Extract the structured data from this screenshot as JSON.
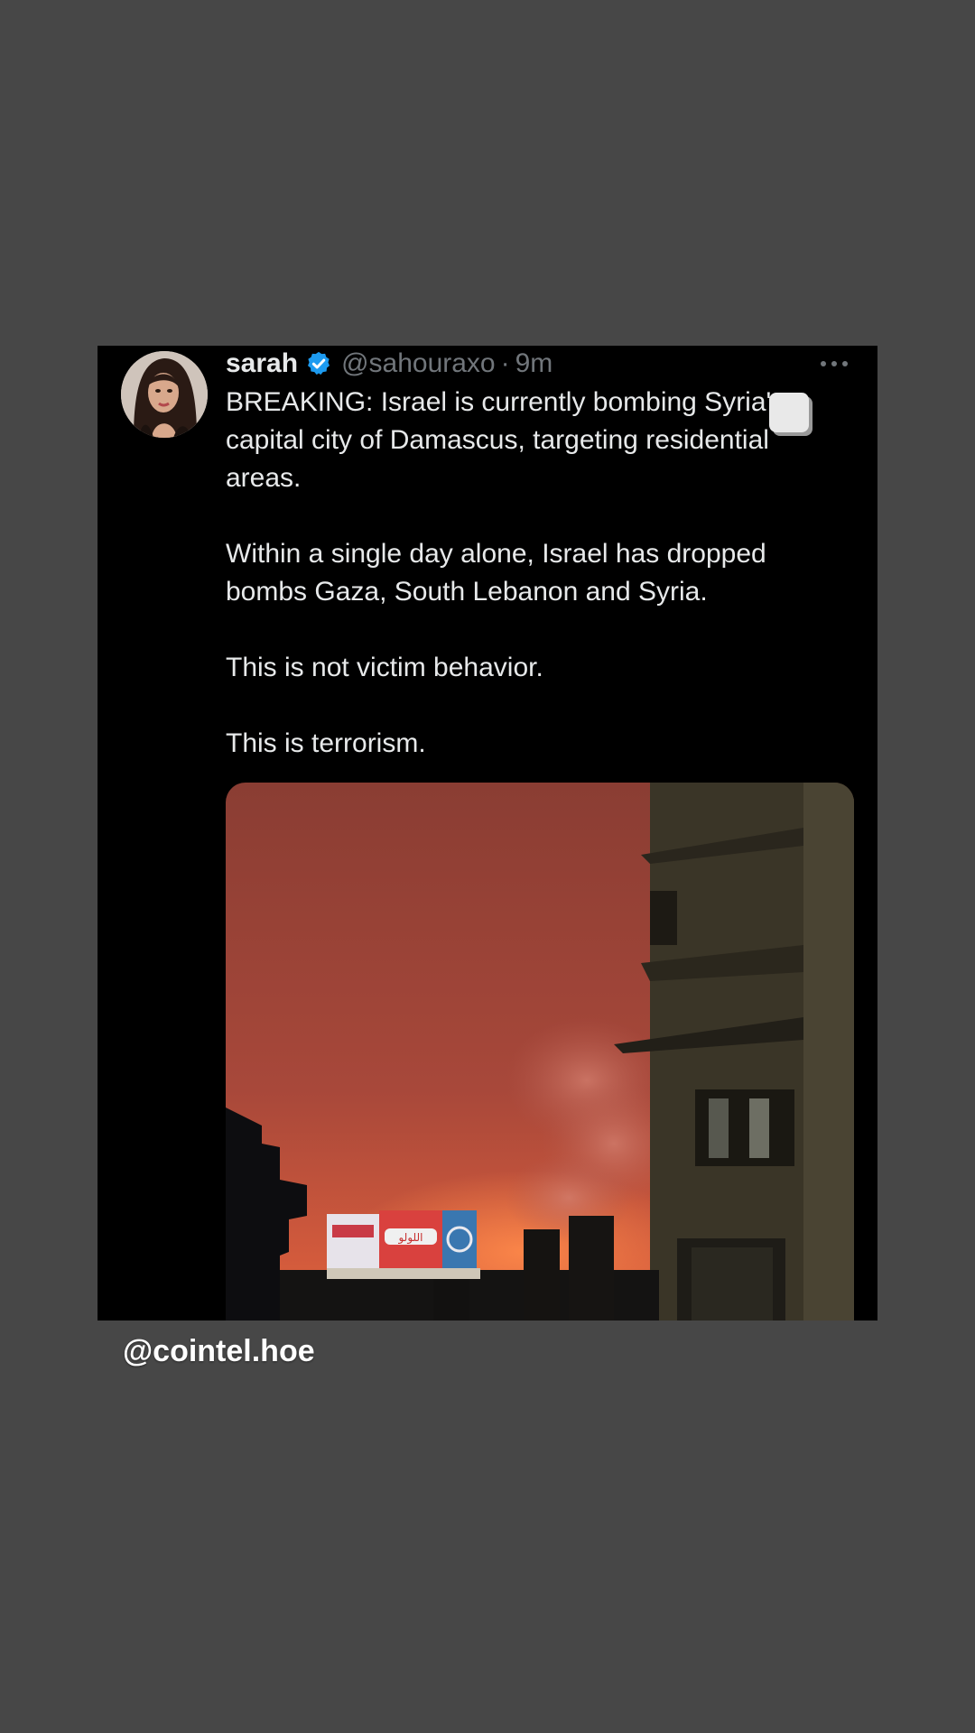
{
  "tweet": {
    "display_name": "sarah",
    "handle": "@sahouraxo",
    "separator": "·",
    "time": "9m",
    "paragraphs": [
      "BREAKING: Israel is currently bombing Syria's\ncapital city of Damascus, targeting residential\nareas.",
      "Within a single day alone, Israel has dropped\nbombs Gaza, South Lebanon and Syria.",
      "This is not victim behavior.",
      "This is terrorism."
    ],
    "verified_color": "#1d9bf0",
    "media_billboard_text": "اللولو"
  },
  "story": {
    "watermark": "@cointel.hoe",
    "background_color": "#474747"
  }
}
